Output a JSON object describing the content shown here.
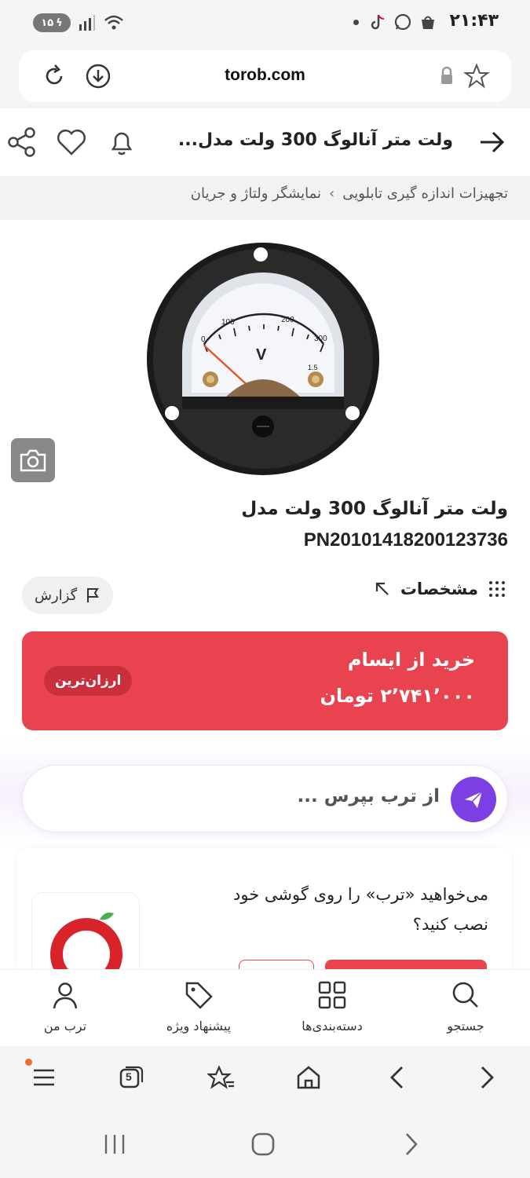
{
  "status_bar": {
    "time": "۲۱:۴۳",
    "battery": "۱۵"
  },
  "browser": {
    "url": "torob.com"
  },
  "header": {
    "title": "ولت متر آنالوگ 300 ولت مدل..."
  },
  "breadcrumb": {
    "items": [
      "تجهیزات اندازه گیری تابلویی",
      "نمایشگر ولتاژ و جریان"
    ],
    "separator": "›"
  },
  "meter_image": {
    "scale": [
      "0",
      "100",
      "200",
      "300"
    ],
    "unit": "V",
    "class": "1.5"
  },
  "product": {
    "title_line1": "ولت متر آنالوگ 300 ولت مدل",
    "title_line2": "PN20101418200123736"
  },
  "actions": {
    "specs_label": "مشخصات",
    "report_label": "گزارش"
  },
  "offer": {
    "shop_label": "خرید از ایسام",
    "price": "۲٬۷۴۱٬۰۰۰ تومان",
    "badge": "ارزان‌ترین"
  },
  "ask": {
    "placeholder": "از ترب بپرس ..."
  },
  "install": {
    "line1": "می‌خواهید «ترب» را روی گوشی خود",
    "line2": "نصب کنید؟"
  },
  "bottom_nav": {
    "search": "جستجو",
    "categories": "دسته‌بندی‌ها",
    "offers": "پیشنهاد ویژه",
    "profile": "ترب من"
  },
  "browser_bar": {
    "tabs_count": "5"
  },
  "colors": {
    "accent_red": "#e8434f",
    "accent_purple": "#7b3fe4"
  }
}
